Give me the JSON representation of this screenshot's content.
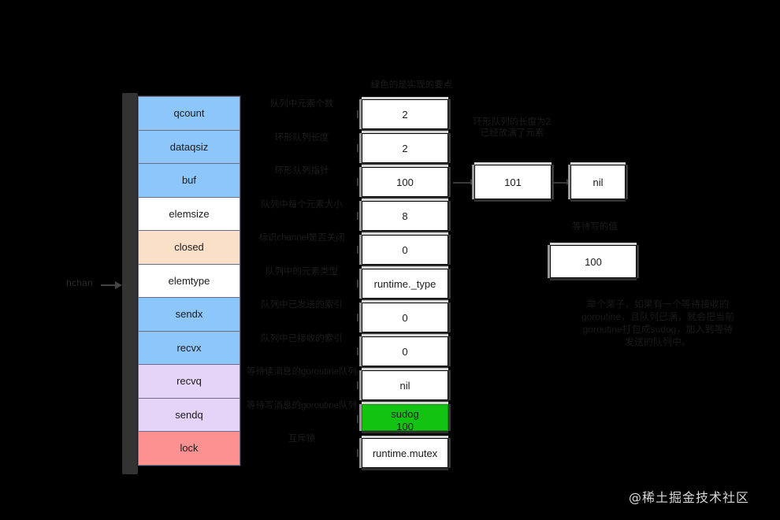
{
  "diagram": {
    "title_label": "hchan",
    "watermark": "@稀土掘金技术社区"
  },
  "fields": [
    {
      "name": "qcount",
      "color": "#8CC6FB",
      "annotation": "队列中元素个数"
    },
    {
      "name": "dataqsiz",
      "color": "#8CC6FB",
      "annotation": "环形队列长度"
    },
    {
      "name": "buf",
      "color": "#8CC6FB",
      "annotation": "环形队列指针"
    },
    {
      "name": "elemsize",
      "color": "#FFFFFF",
      "annotation": "队列中每个元素大小"
    },
    {
      "name": "closed",
      "color": "#FBE0C8",
      "annotation": "标识channel是否关闭"
    },
    {
      "name": "elemtype",
      "color": "#FFFFFF",
      "annotation": "队列中的元素类型"
    },
    {
      "name": "sendx",
      "color": "#8CC6FB",
      "annotation": "队列中已发送的索引"
    },
    {
      "name": "recvx",
      "color": "#8CC6FB",
      "annotation": "队列中已接收的索引"
    },
    {
      "name": "recvq",
      "color": "#E5D4F7",
      "annotation": "等待读消息的goroutine队列"
    },
    {
      "name": "sendq",
      "color": "#E5D4F7",
      "annotation": "等待写消息的goroutine队列"
    },
    {
      "name": "lock",
      "color": "#FB9191",
      "annotation": "互斥锁"
    }
  ],
  "values": [
    {
      "text": "2",
      "green": false
    },
    {
      "text": "2",
      "green": false
    },
    {
      "text": "100",
      "green": false
    },
    {
      "text": "8",
      "green": false
    },
    {
      "text": "0",
      "green": false
    },
    {
      "text": "runtime._type",
      "green": false
    },
    {
      "text": "0",
      "green": false
    },
    {
      "text": "0",
      "green": false
    },
    {
      "text": "nil",
      "green": false
    },
    {
      "text": "sudog\n100",
      "green": true,
      "line1": "sudog",
      "line2": "100"
    },
    {
      "text": "runtime.mutex",
      "green": false
    }
  ],
  "values_header": "绿色的是实现的要点",
  "buffer_chain": {
    "note": "环形队列的长度为2\n已经放满了元素",
    "boxes": [
      {
        "text": "101"
      },
      {
        "text": "nil"
      }
    ]
  },
  "sudog_detail": {
    "note": "等待写的值",
    "box": {
      "text": "100"
    },
    "paragraph": "举个栗子，如果有一个等待接收的goroutine，且队列已满，就会把当前goroutine打包成sudog，加入到等待发送的队列中。"
  },
  "colors": {
    "background": "#000000",
    "blue": "#8CC6FB",
    "peach": "#FBE0C8",
    "lavender": "#E5D4F7",
    "pink": "#FB9191",
    "white": "#FFFFFF",
    "green": "#12c312",
    "frame": "#333333",
    "annotation_text": "#1c1c1c",
    "watermark_text": "#d9d9d9"
  }
}
